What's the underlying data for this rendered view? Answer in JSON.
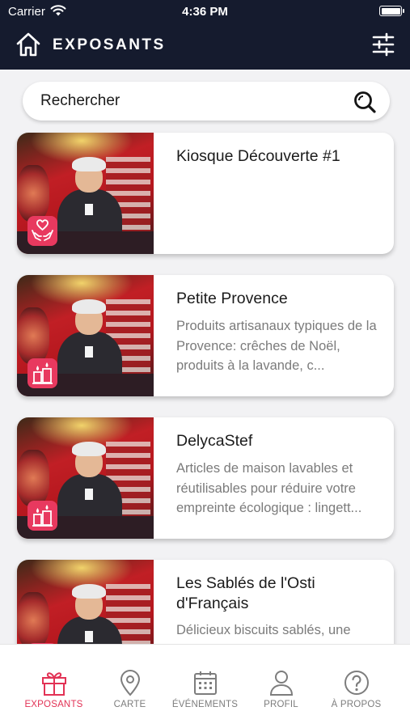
{
  "status_bar": {
    "carrier": "Carrier",
    "time": "4:36 PM",
    "battery_level": 1.0
  },
  "header": {
    "title": "EXPOSANTS",
    "home_icon": "home-icon",
    "filter_icon": "sliders-icon"
  },
  "search": {
    "placeholder": "Rechercher",
    "icon": "search-icon"
  },
  "exhibitors": [
    {
      "title": "Kiosque Découverte #1",
      "description": "",
      "category_icon": "hands-heart-icon"
    },
    {
      "title": "Petite Provence",
      "description": "Produits artisanaux typiques de la Provence: crêches de Noël, produits à la lavande, c...",
      "category_icon": "candles-icon"
    },
    {
      "title": "DelycaStef",
      "description": "Articles de maison lavables et réutilisables pour réduire votre empreinte écologique : lingett...",
      "category_icon": "candles-icon"
    },
    {
      "title": "Les Sablés de l'Osti d'Français",
      "description": "Délicieux biscuits sablés, une",
      "category_icon": "candles-icon"
    }
  ],
  "tabbar": {
    "tabs": [
      {
        "label": "EXPOSANTS",
        "icon": "gift-icon",
        "active": true
      },
      {
        "label": "CARTE",
        "icon": "map-pin-icon",
        "active": false
      },
      {
        "label": "ÉVÉNEMENTS",
        "icon": "calendar-icon",
        "active": false
      },
      {
        "label": "PROFIL",
        "icon": "user-icon",
        "active": false
      },
      {
        "label": "À PROPOS",
        "icon": "question-icon",
        "active": false
      }
    ]
  },
  "colors": {
    "header_bg": "#151b2e",
    "accent": "#e23255",
    "badge": "#e8395f",
    "muted": "#7b7b7b"
  }
}
